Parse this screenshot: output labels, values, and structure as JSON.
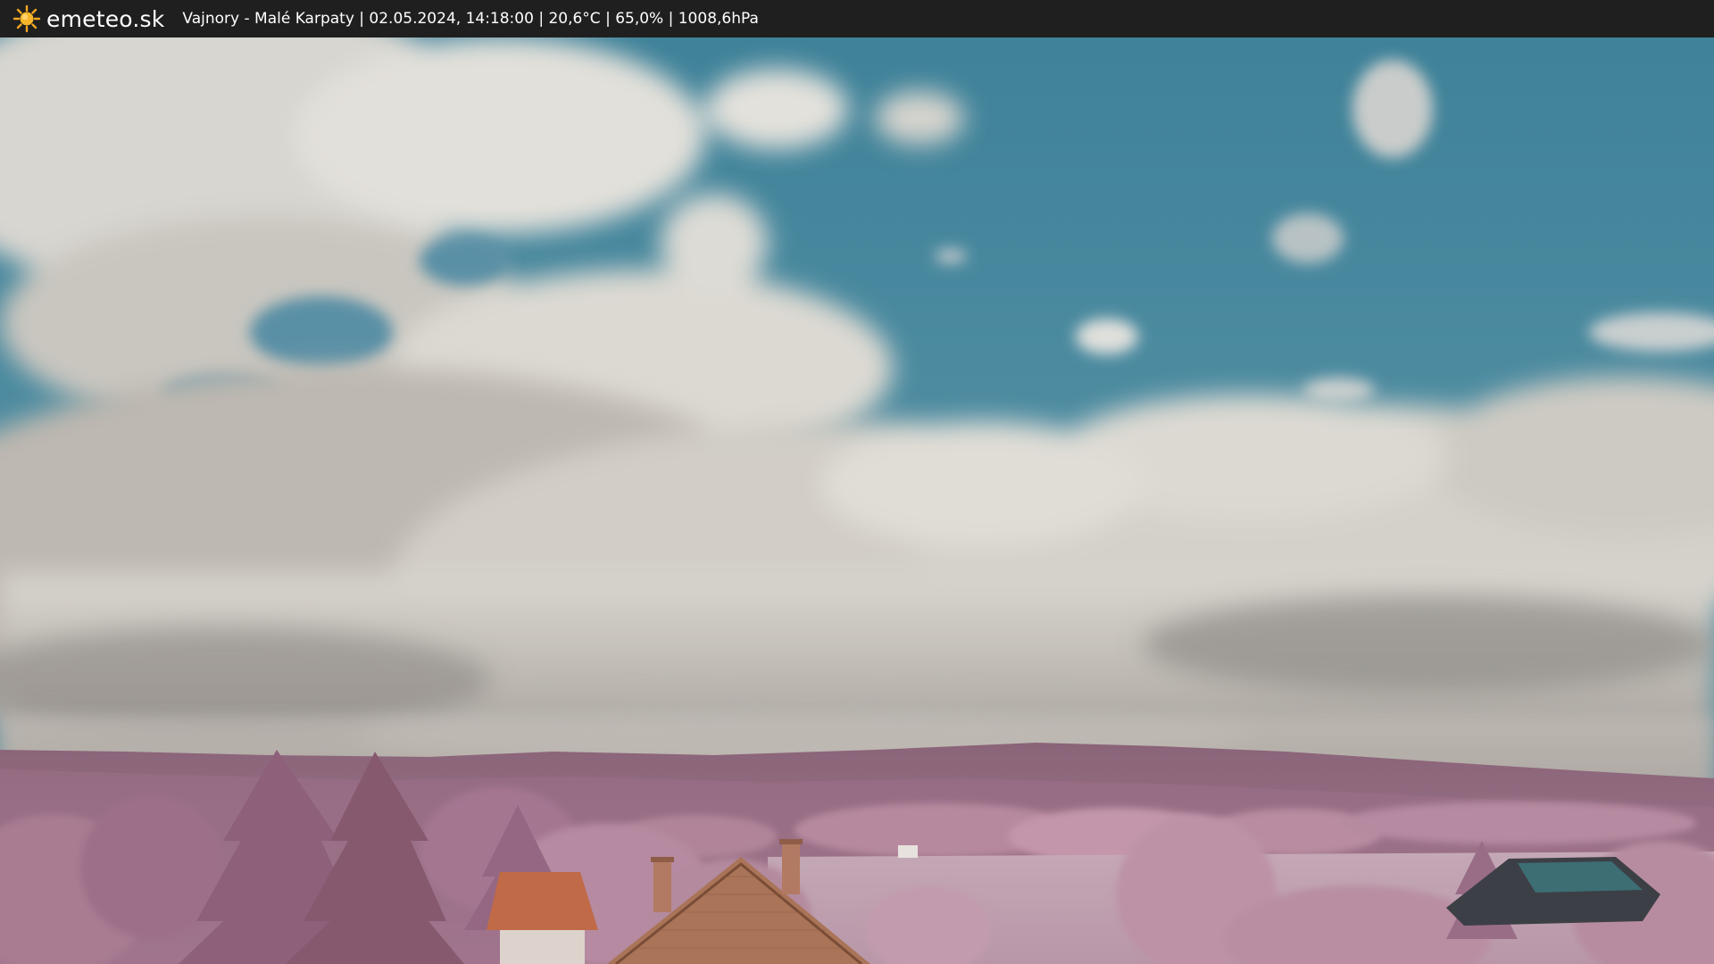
{
  "header": {
    "brand": "emeteo.sk",
    "brand_icon": "sun-icon",
    "caption": "Vajnory - Malé Karpaty | 02.05.2024, 14:18:00 | 20,6°C | 65,0% | 1008,6hPa"
  },
  "colors": {
    "bar_background": "#1f1f1f",
    "sun": "#f5a623",
    "sky": "#3d8099",
    "foliage": "#b07c98"
  }
}
